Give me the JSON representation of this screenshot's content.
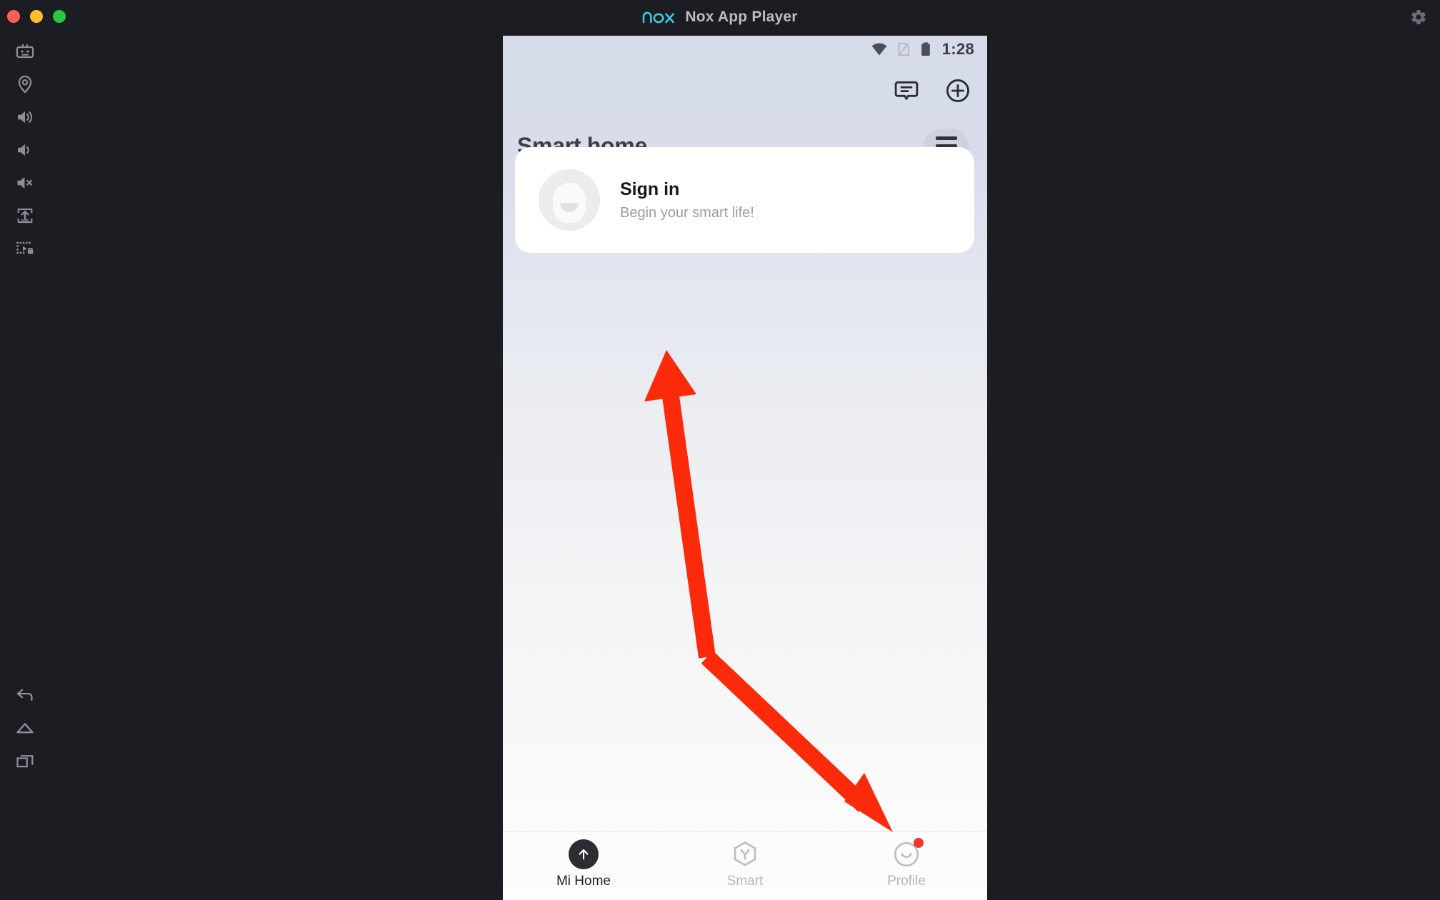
{
  "window": {
    "app_title": "Nox App Player",
    "logo_text": "nox",
    "logo_color": "#3ec8e0",
    "traffic_lights": [
      {
        "name": "close",
        "color": "#ff5f57"
      },
      {
        "name": "minimize",
        "color": "#ffbd2e"
      },
      {
        "name": "maximize",
        "color": "#28c840"
      }
    ],
    "settings_icon": "gear-icon"
  },
  "sidebar": {
    "top_items": [
      {
        "icon": "keyboard-mapping-icon",
        "label": "Keyboard control"
      },
      {
        "icon": "location-pin-icon",
        "label": "Location"
      },
      {
        "icon": "volume-up-icon",
        "label": "Volume up"
      },
      {
        "icon": "volume-down-icon",
        "label": "Volume down"
      },
      {
        "icon": "volume-mute-icon",
        "label": "Mute"
      },
      {
        "icon": "apk-install-icon",
        "label": "Install APK"
      },
      {
        "icon": "screen-record-icon",
        "label": "Screen recorder"
      }
    ],
    "bottom_items": [
      {
        "icon": "back-icon",
        "label": "Back"
      },
      {
        "icon": "home-icon",
        "label": "Home"
      },
      {
        "icon": "recent-apps-icon",
        "label": "Recent apps"
      }
    ]
  },
  "phone": {
    "statusbar": {
      "wifi_icon": "wifi-icon",
      "sim_icon": "sim-card-off-icon",
      "battery_icon": "battery-icon",
      "clock": "1:28"
    },
    "app": {
      "top_actions": [
        {
          "icon": "message-bubble-icon",
          "label": "Messages"
        },
        {
          "icon": "plus-circle-icon",
          "label": "Add device"
        }
      ],
      "page_title": "Smart home",
      "menu_button": {
        "icon": "hamburger-menu-icon",
        "label": "Menu"
      },
      "signin_card": {
        "avatar_icon": "default-avatar-icon",
        "title": "Sign in",
        "subtitle": "Begin your smart life!"
      },
      "bottom_nav": [
        {
          "label": "Mi Home",
          "icon": "mi-home-arrow-icon",
          "active": true,
          "badge": false
        },
        {
          "label": "Smart",
          "icon": "smart-hexagon-icon",
          "active": false,
          "badge": false
        },
        {
          "label": "Profile",
          "icon": "profile-smiley-icon",
          "active": false,
          "badge": true
        }
      ]
    }
  },
  "annotation": {
    "type": "double-headed-arrow",
    "color": "#fa2a0a",
    "description": "Red arrow pointing from upper area down to the Profile tab"
  }
}
